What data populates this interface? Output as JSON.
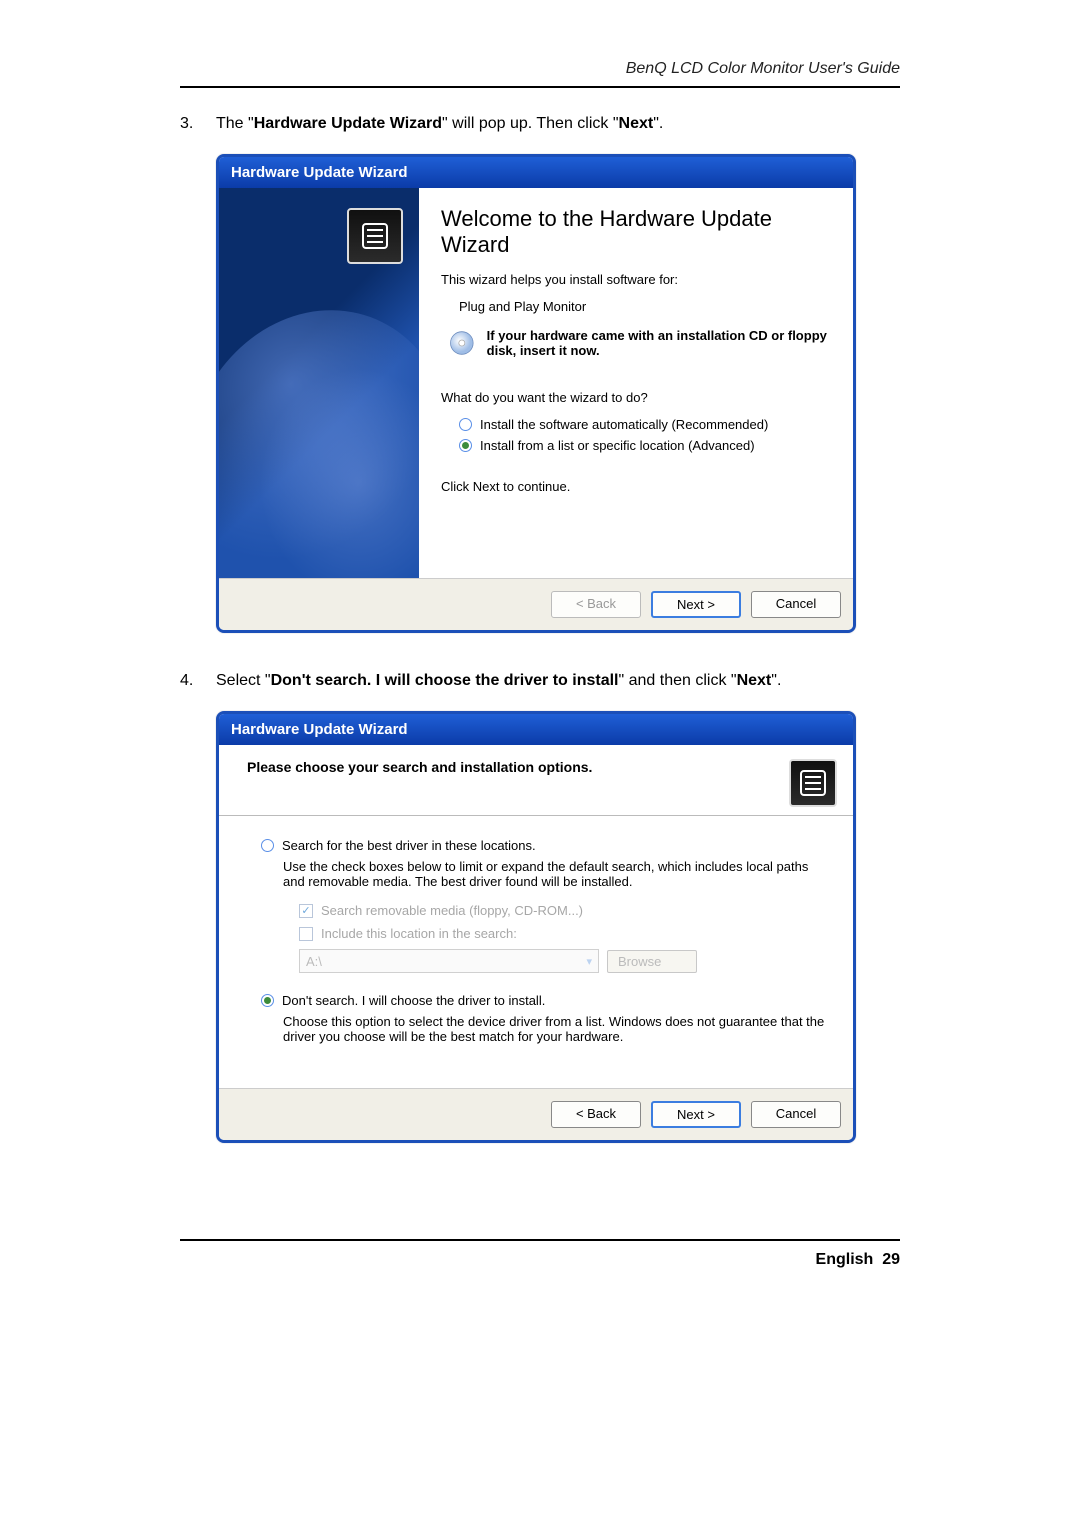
{
  "page": {
    "header": "BenQ LCD Color Monitor User's Guide",
    "footer_lang": "English",
    "footer_page": "29"
  },
  "step3": {
    "num": "3.",
    "pre": "The \"",
    "b1": "Hardware Update Wizard",
    "mid": "\" will pop up. Then click \"",
    "b2": "Next",
    "post": "\"."
  },
  "step4": {
    "num": "4.",
    "pre": "Select \"",
    "b1": "Don't search. I will choose the driver to install",
    "mid": "\" and then click \"",
    "b2": "Next",
    "post": "\"."
  },
  "dlg1": {
    "title": "Hardware Update Wizard",
    "welcome": "Welcome to the Hardware Update Wizard",
    "line1": "This wizard helps you install software for:",
    "device": "Plug and Play Monitor",
    "cd_hint": "If your hardware came with an installation CD or floppy disk, insert it now.",
    "question": "What do you want the wizard to do?",
    "opt_auto": "Install the software automatically (Recommended)",
    "opt_adv": "Install from a list or specific location (Advanced)",
    "click_next": "Click Next to continue.",
    "btn_back": "< Back",
    "btn_next": "Next >",
    "btn_cancel": "Cancel"
  },
  "dlg2": {
    "title": "Hardware Update Wizard",
    "heading": "Please choose your search and installation options.",
    "opt_search": "Search for the best driver in these locations.",
    "search_desc": "Use the check boxes below to limit or expand the default search, which includes local paths and removable media. The best driver found will be installed.",
    "chk_removable": "Search removable media (floppy, CD-ROM...)",
    "chk_include": "Include this location in the search:",
    "path": "A:\\",
    "browse": "Browse",
    "opt_nosearch": "Don't search. I will choose the driver to install.",
    "nosearch_desc": "Choose this option to select the device driver from a list.  Windows does not guarantee that the driver you choose will be the best match for your hardware.",
    "btn_back": "< Back",
    "btn_next": "Next >",
    "btn_cancel": "Cancel"
  }
}
